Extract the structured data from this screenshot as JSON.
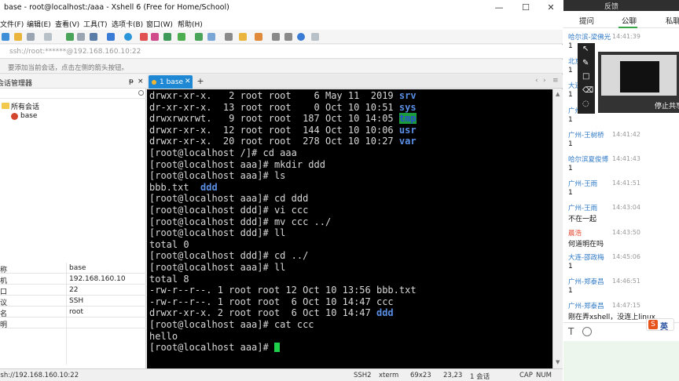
{
  "window": {
    "title": "base - root@localhost:/aaa - Xshell 6 (Free for Home/School)",
    "minimize": "—",
    "maximize": "☐",
    "close": "✕"
  },
  "menu": [
    "文件(F)",
    "编辑(E)",
    "查看(V)",
    "工具(T)",
    "选项卡(B)",
    "窗口(W)",
    "帮助(H)"
  ],
  "address_bar": "ssh://root:******@192.168.160.10:22",
  "hint_bar": "要添加当前会话，点击左侧的箭头按钮。",
  "session_manager": {
    "header": "会话管理器",
    "pin": "ᵽ",
    "close": "×",
    "root_folder": "所有会话",
    "session": "base",
    "properties": [
      {
        "key": "名称",
        "value": "base"
      },
      {
        "key": "主机",
        "value": "192.168.160.10"
      },
      {
        "key": "端口",
        "value": "22"
      },
      {
        "key": "协议",
        "value": "SSH"
      },
      {
        "key": "用户名",
        "value": "root"
      },
      {
        "key": "说明",
        "value": ""
      }
    ]
  },
  "tabs": [
    {
      "label": "1 base"
    }
  ],
  "terminal": {
    "lines": [
      {
        "pre": "drwxr-xr-x.   2 root root    6 May 11  2019 ",
        "name": "srv",
        "style": "blue"
      },
      {
        "pre": "dr-xr-xr-x.  13 root root    0 Oct 10 10:51 ",
        "name": "sys",
        "style": "blue"
      },
      {
        "pre": "drwxrwxrwt.   9 root root  187 Oct 10 14:05 ",
        "name": "tmp",
        "style": "hl"
      },
      {
        "pre": "drwxr-xr-x.  12 root root  144 Oct 10 10:06 ",
        "name": "usr",
        "style": "blue"
      },
      {
        "pre": "drwxr-xr-x.  20 root root  278 Oct 10 10:27 ",
        "name": "var",
        "style": "blue"
      },
      {
        "pre": "[root@localhost /]# cd aaa",
        "name": "",
        "style": ""
      },
      {
        "pre": "[root@localhost aaa]# mkdir ddd",
        "name": "",
        "style": ""
      },
      {
        "pre": "[root@localhost aaa]# ls",
        "name": "",
        "style": ""
      },
      {
        "pre": "bbb.txt  ",
        "name": "ddd",
        "style": "blue"
      },
      {
        "pre": "[root@localhost aaa]# cd ddd",
        "name": "",
        "style": ""
      },
      {
        "pre": "[root@localhost ddd]# vi ccc",
        "name": "",
        "style": ""
      },
      {
        "pre": "[root@localhost ddd]# mv ccc ../",
        "name": "",
        "style": ""
      },
      {
        "pre": "[root@localhost ddd]# ll",
        "name": "",
        "style": ""
      },
      {
        "pre": "total 0",
        "name": "",
        "style": ""
      },
      {
        "pre": "[root@localhost ddd]# cd ../",
        "name": "",
        "style": ""
      },
      {
        "pre": "[root@localhost aaa]# ll",
        "name": "",
        "style": ""
      },
      {
        "pre": "total 8",
        "name": "",
        "style": ""
      },
      {
        "pre": "-rw-r--r--. 1 root root 12 Oct 10 13:56 bbb.txt",
        "name": "",
        "style": ""
      },
      {
        "pre": "-rw-r--r--. 1 root root  6 Oct 10 14:47 ccc",
        "name": "",
        "style": ""
      },
      {
        "pre": "drwxr-xr-x. 2 root root  6 Oct 10 14:47 ",
        "name": "ddd",
        "style": "blue"
      },
      {
        "pre": "[root@localhost aaa]# cat ccc",
        "name": "",
        "style": ""
      },
      {
        "pre": "hello",
        "name": "",
        "style": ""
      },
      {
        "pre": "[root@localhost aaa]# ",
        "name": "",
        "style": "cursor"
      }
    ]
  },
  "status_bar": {
    "connection": "ssh://192.168.160.10:22",
    "protocol": "SSH2",
    "term": "xterm",
    "size": "69x23",
    "position": "23,23",
    "sessions": "1 会话",
    "caps": "CAP",
    "num": "NUM"
  },
  "chat": {
    "feedback": "反馈",
    "tabs": [
      "提问",
      "公聊",
      "私聊"
    ],
    "stop_share": "停止共享",
    "messages": [
      {
        "name": "哈尔滨-梁佛光",
        "time": "14:41:39",
        "text": "1",
        "name_color": "blue"
      },
      {
        "name": "北京",
        "time": "",
        "text": "1",
        "name_color": "blue"
      },
      {
        "name": "大连",
        "time": "",
        "text": "1",
        "name_color": "blue"
      },
      {
        "name": "广州",
        "time": "",
        "text": "1",
        "name_color": "blue"
      },
      {
        "name": "广州-王树桥",
        "time": "14:41:42",
        "text": "1",
        "name_color": "blue"
      },
      {
        "name": "哈尔滨夏俊博",
        "time": "14:41:43",
        "text": "1",
        "name_color": "blue"
      },
      {
        "name": "广州-王雨",
        "time": "14:41:51",
        "text": "1",
        "name_color": "blue"
      },
      {
        "name": "广州-王雨",
        "time": "14:43:04",
        "text": "不在一起",
        "name_color": "blue"
      },
      {
        "name": "晨浩",
        "time": "14:43:50",
        "text": "何道明在吗",
        "name_color": "red"
      },
      {
        "name": "大连-邵政梅",
        "time": "14:45:06",
        "text": "1",
        "name_color": "blue"
      },
      {
        "name": "广州-郑泰昌",
        "time": "14:46:51",
        "text": "1",
        "name_color": "blue"
      },
      {
        "name": "广州-郑泰昌",
        "time": "14:47:15",
        "text": "刚在弄xshell，没连上linux",
        "name_color": "blue"
      }
    ],
    "ime_logo": "S",
    "ime_mode": "英"
  }
}
